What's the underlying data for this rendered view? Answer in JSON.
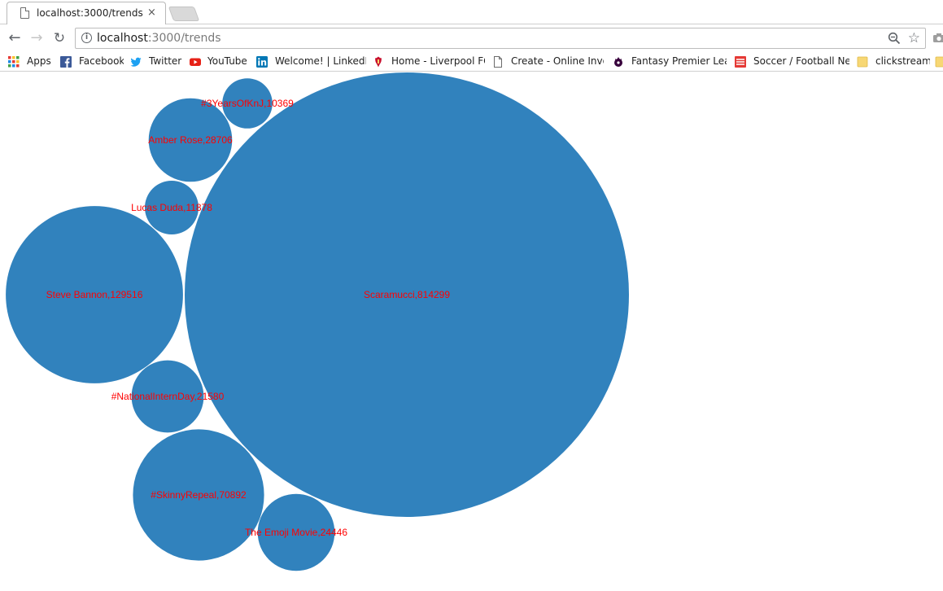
{
  "tab": {
    "title": "localhost:3000/trends",
    "close_glyph": "×",
    "icon": "page-icon"
  },
  "toolbar": {
    "back_glyph": "←",
    "forward_glyph": "→",
    "reload_glyph": "↻",
    "url_host": "localhost",
    "url_path": ":3000/trends",
    "star_glyph": "☆"
  },
  "bookmarks": [
    {
      "label": "Apps",
      "icon": "apps-grid-icon"
    },
    {
      "label": "Facebook",
      "icon": "facebook-icon",
      "color": "#3b5998"
    },
    {
      "label": "Twitter",
      "icon": "twitter-icon",
      "color": "#1da1f2"
    },
    {
      "label": "YouTube",
      "icon": "youtube-icon",
      "color": "#e62117"
    },
    {
      "label": "Welcome! | LinkedIn",
      "icon": "linkedin-icon",
      "color": "#0077b5"
    },
    {
      "label": "Home - Liverpool FC",
      "icon": "liverpool-crest-icon",
      "color": "#c8102e"
    },
    {
      "label": "Create - Online Invoic",
      "icon": "page-icon"
    },
    {
      "label": "Fantasy Premier Leag",
      "icon": "premier-league-icon",
      "color": "#37003c"
    },
    {
      "label": "Soccer / Football New",
      "icon": "soccer-news-icon",
      "color": "#e53935"
    },
    {
      "label": "clickstream",
      "icon": "folder-icon",
      "color": "#f7d774"
    }
  ],
  "chart_data": {
    "type": "bubble",
    "bubble_color": "#3182bd",
    "label_color": "#ff0000",
    "series": [
      {
        "name": "Scaramucci",
        "value": 814299
      },
      {
        "name": "Steve Bannon",
        "value": 129516
      },
      {
        "name": "#SkinnyRepeal",
        "value": 70892
      },
      {
        "name": "Amber Rose",
        "value": 28706
      },
      {
        "name": "The Emoji Movie",
        "value": 24446
      },
      {
        "name": "#NationalInternDay",
        "value": 21580
      },
      {
        "name": "Lucas Duda",
        "value": 11878
      },
      {
        "name": "#3YearsOfKnJ",
        "value": 10369
      }
    ]
  }
}
